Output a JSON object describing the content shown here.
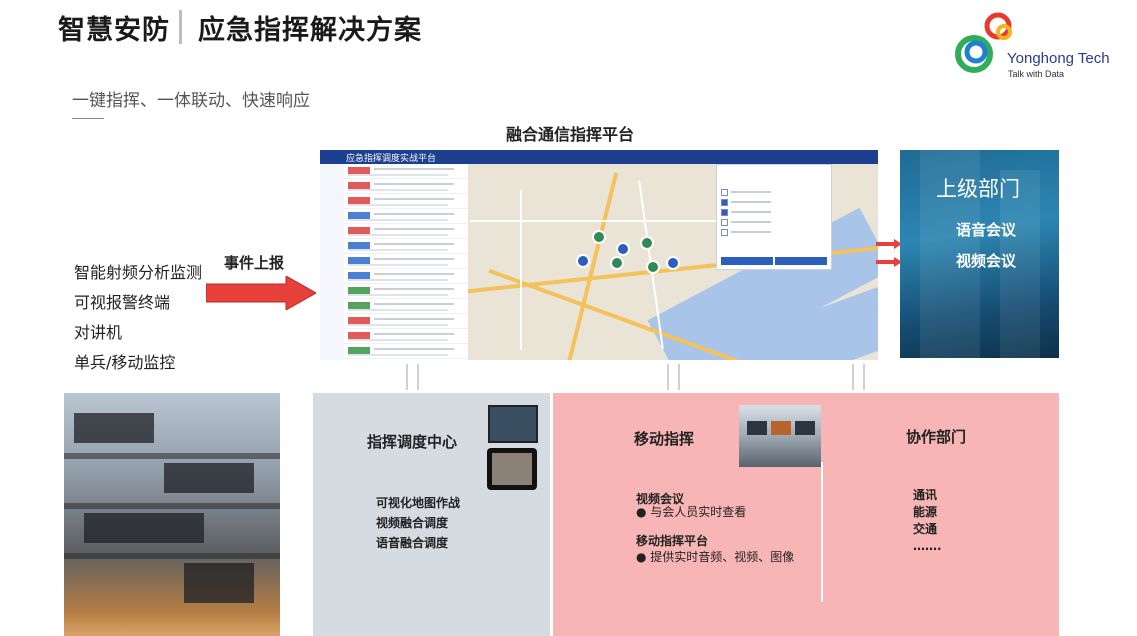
{
  "header": {
    "title_part1": "智慧安防",
    "title_part2": "应急指挥解决方案",
    "subtitle": "一键指挥、一体联动、快速响应"
  },
  "logo": {
    "name": "Yonghong Tech",
    "tagline": "Talk with Data",
    "colors": [
      "#e83a2f",
      "#f5b41a",
      "#2fae5a",
      "#1f7fd1"
    ]
  },
  "platform": {
    "title": "融合通信指挥平台",
    "screen_title": "应急指挥调度实战平台"
  },
  "left": {
    "items": [
      "智能射频分析监测",
      "可视报警终端",
      "对讲机",
      "单兵/移动监控"
    ],
    "report_label": "事件上报"
  },
  "superior": {
    "title": "上级部门",
    "items": [
      "语音会议",
      "视频会议"
    ]
  },
  "command_center": {
    "title": "指挥调度中心",
    "items": [
      "可视化地图作战",
      "视频融合调度",
      "语音融合调度"
    ]
  },
  "mobile": {
    "title": "移动指挥",
    "section1_title": "视频会议",
    "section1_bullet": "与会人员实时查看",
    "section2_title": "移动指挥平台",
    "section2_bullet": "提供实时音频、视频、图像"
  },
  "cooperation": {
    "title": "协作部门",
    "items": [
      "通讯",
      "能源",
      "交通",
      "……."
    ]
  },
  "colors": {
    "arrow_red": "#e8403a",
    "pink_panel": "#f7b5b5",
    "grey_panel": "#d6dbe2",
    "screen_bar": "#1d3f8f"
  }
}
